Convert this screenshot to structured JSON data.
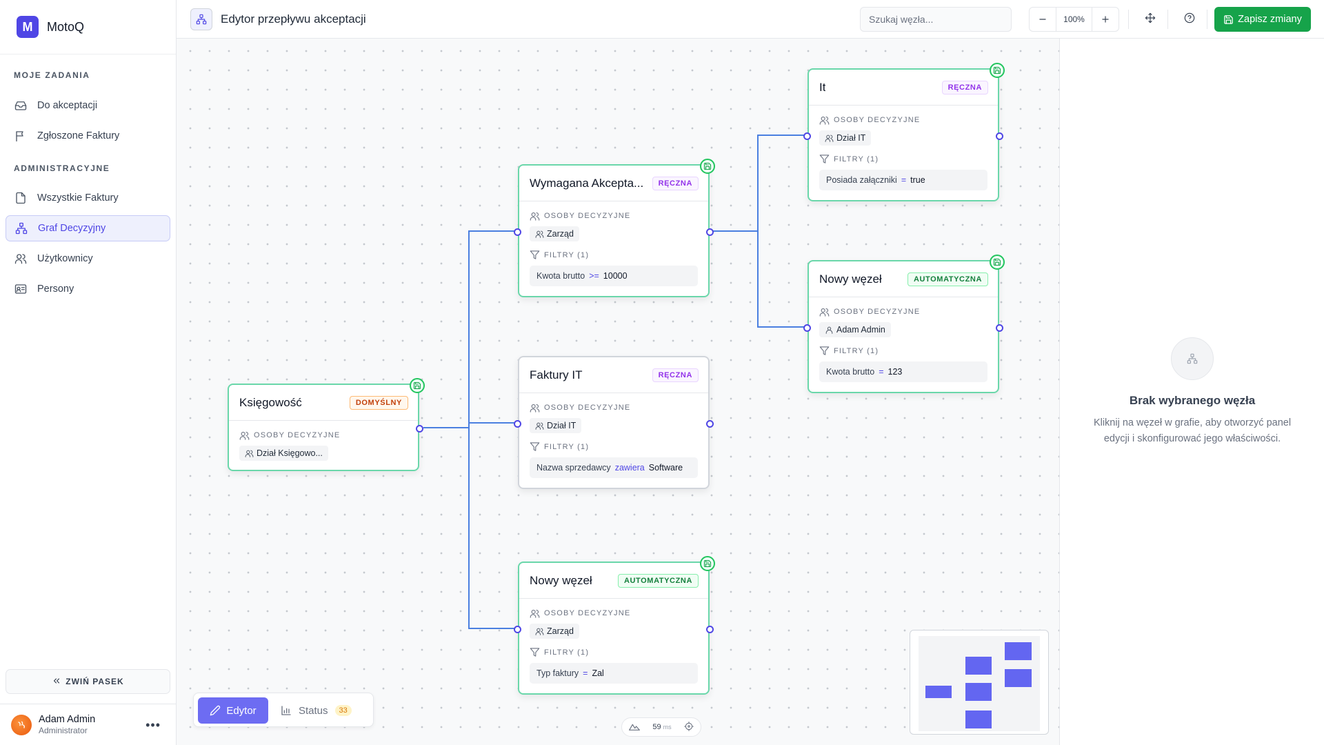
{
  "brand": {
    "initial": "M",
    "name": "MotoQ"
  },
  "sidebar": {
    "section_tasks": "MOJE ZADANIA",
    "section_admin": "ADMINISTRACYJNE",
    "items": [
      {
        "label": "Do akceptacji",
        "icon": "inbox-icon"
      },
      {
        "label": "Zgłoszone Faktury",
        "icon": "flag-icon"
      },
      {
        "label": "Wszystkie Faktury",
        "icon": "file-icon"
      },
      {
        "label": "Graf Decyzyjny",
        "icon": "network-icon",
        "active": true
      },
      {
        "label": "Użytkownicy",
        "icon": "users-icon"
      },
      {
        "label": "Persony",
        "icon": "id-card-icon"
      }
    ],
    "collapse_label": "ZWIŃ PASEK"
  },
  "user": {
    "name": "Adam Admin",
    "role": "Administrator"
  },
  "topbar": {
    "title": "Edytor przepływu akceptacji",
    "search_placeholder": "Szukaj węzła...",
    "zoom_level": "100%",
    "save_label": "Zapisz zmiany"
  },
  "canvas": {
    "nodes": [
      {
        "id": "ksiegowosc",
        "title": "Księgowość",
        "badge": "DOMYŚLNY",
        "people_label": "OSOBY DECYZYJNE",
        "people": "Dział Księgowo..."
      },
      {
        "id": "wymagana",
        "title": "Wymagana Akcepta...",
        "badge": "RĘCZNA",
        "people_label": "OSOBY DECYZYJNE",
        "people": "Zarząd",
        "filters_label": "FILTRY (1)",
        "filter": {
          "field": "Kwota brutto",
          "op": ">=",
          "value": "10000"
        }
      },
      {
        "id": "faktury-it",
        "title": "Faktury IT",
        "badge": "RĘCZNA",
        "people_label": "OSOBY DECYZYJNE",
        "people": "Dział IT",
        "filters_label": "FILTRY (1)",
        "filter": {
          "field": "Nazwa sprzedawcy",
          "op": "zawiera",
          "value": "Software"
        }
      },
      {
        "id": "nowy-bottom",
        "title": "Nowy węzeł",
        "badge": "AUTOMATYCZNA",
        "people_label": "OSOBY DECYZYJNE",
        "people": "Zarząd",
        "filters_label": "FILTRY (1)",
        "filter": {
          "field": "Typ faktury",
          "op": "=",
          "value": "Zal"
        }
      },
      {
        "id": "it",
        "title": "It",
        "badge": "RĘCZNA",
        "people_label": "OSOBY DECYZYJNE",
        "people": "Dział IT",
        "filters_label": "FILTRY (1)",
        "filter": {
          "field": "Posiada załączniki",
          "op": "=",
          "value": "true"
        }
      },
      {
        "id": "nowy-right",
        "title": "Nowy węzeł",
        "badge": "AUTOMATYCZNA",
        "people_label": "OSOBY DECYZYJNE",
        "people": "Adam Admin",
        "filters_label": "FILTRY (1)",
        "filter": {
          "field": "Kwota brutto",
          "op": "=",
          "value": "123"
        }
      }
    ]
  },
  "bottombar": {
    "edit_label": "Edytor",
    "status_label": "Status",
    "status_count": "33",
    "perf_value": "59",
    "perf_unit": "ms"
  },
  "panel": {
    "empty_title": "Brak wybranego węzła",
    "empty_desc": "Kliknij na węzeł w grafie, aby otworzyć panel edycji i skonfigurować jego właściwości."
  },
  "colors": {
    "accent": "#4f46e5",
    "success": "#16a34a",
    "node_border": "#6ad7aa",
    "edge": "#4a7fe0"
  }
}
